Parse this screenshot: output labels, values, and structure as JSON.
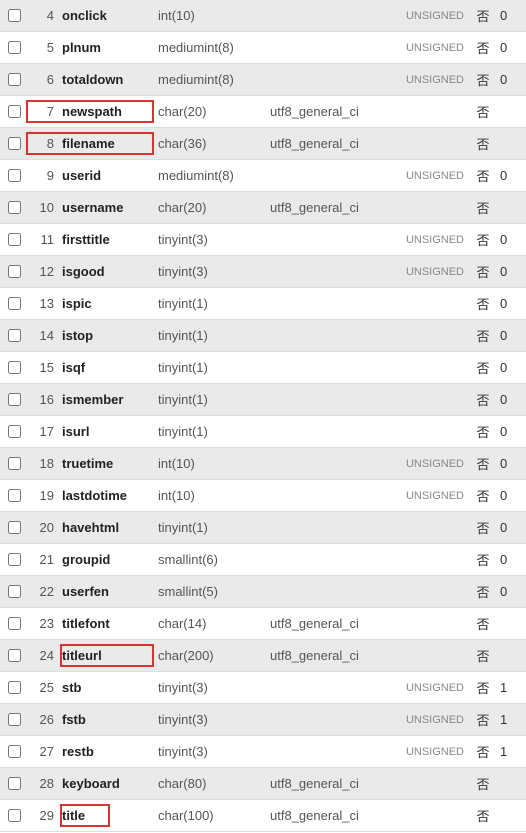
{
  "labels": {
    "unsigned": "UNSIGNED",
    "no": "否"
  },
  "rows": [
    {
      "n": "4",
      "name": "onclick",
      "type": "int(10)",
      "coll": "",
      "attr": "UNSIGNED",
      "nul": "否",
      "dft": "0",
      "alt": true,
      "hl": false
    },
    {
      "n": "5",
      "name": "plnum",
      "type": "mediumint(8)",
      "coll": "",
      "attr": "UNSIGNED",
      "nul": "否",
      "dft": "0",
      "alt": false,
      "hl": false
    },
    {
      "n": "6",
      "name": "totaldown",
      "type": "mediumint(8)",
      "coll": "",
      "attr": "UNSIGNED",
      "nul": "否",
      "dft": "0",
      "alt": true,
      "hl": false
    },
    {
      "n": "7",
      "name": "newspath",
      "type": "char(20)",
      "coll": "utf8_general_ci",
      "attr": "",
      "nul": "否",
      "dft": "",
      "alt": false,
      "hl": true
    },
    {
      "n": "8",
      "name": "filename",
      "type": "char(36)",
      "coll": "utf8_general_ci",
      "attr": "",
      "nul": "否",
      "dft": "",
      "alt": true,
      "hl": true
    },
    {
      "n": "9",
      "name": "userid",
      "type": "mediumint(8)",
      "coll": "",
      "attr": "UNSIGNED",
      "nul": "否",
      "dft": "0",
      "alt": false,
      "hl": false
    },
    {
      "n": "10",
      "name": "username",
      "type": "char(20)",
      "coll": "utf8_general_ci",
      "attr": "",
      "nul": "否",
      "dft": "",
      "alt": true,
      "hl": false
    },
    {
      "n": "11",
      "name": "firsttitle",
      "type": "tinyint(3)",
      "coll": "",
      "attr": "UNSIGNED",
      "nul": "否",
      "dft": "0",
      "alt": false,
      "hl": false
    },
    {
      "n": "12",
      "name": "isgood",
      "type": "tinyint(3)",
      "coll": "",
      "attr": "UNSIGNED",
      "nul": "否",
      "dft": "0",
      "alt": true,
      "hl": false
    },
    {
      "n": "13",
      "name": "ispic",
      "type": "tinyint(1)",
      "coll": "",
      "attr": "",
      "nul": "否",
      "dft": "0",
      "alt": false,
      "hl": false
    },
    {
      "n": "14",
      "name": "istop",
      "type": "tinyint(1)",
      "coll": "",
      "attr": "",
      "nul": "否",
      "dft": "0",
      "alt": true,
      "hl": false
    },
    {
      "n": "15",
      "name": "isqf",
      "type": "tinyint(1)",
      "coll": "",
      "attr": "",
      "nul": "否",
      "dft": "0",
      "alt": false,
      "hl": false
    },
    {
      "n": "16",
      "name": "ismember",
      "type": "tinyint(1)",
      "coll": "",
      "attr": "",
      "nul": "否",
      "dft": "0",
      "alt": true,
      "hl": false
    },
    {
      "n": "17",
      "name": "isurl",
      "type": "tinyint(1)",
      "coll": "",
      "attr": "",
      "nul": "否",
      "dft": "0",
      "alt": false,
      "hl": false
    },
    {
      "n": "18",
      "name": "truetime",
      "type": "int(10)",
      "coll": "",
      "attr": "UNSIGNED",
      "nul": "否",
      "dft": "0",
      "alt": true,
      "hl": false
    },
    {
      "n": "19",
      "name": "lastdotime",
      "type": "int(10)",
      "coll": "",
      "attr": "UNSIGNED",
      "nul": "否",
      "dft": "0",
      "alt": false,
      "hl": false
    },
    {
      "n": "20",
      "name": "havehtml",
      "type": "tinyint(1)",
      "coll": "",
      "attr": "",
      "nul": "否",
      "dft": "0",
      "alt": true,
      "hl": false
    },
    {
      "n": "21",
      "name": "groupid",
      "type": "smallint(6)",
      "coll": "",
      "attr": "",
      "nul": "否",
      "dft": "0",
      "alt": false,
      "hl": false
    },
    {
      "n": "22",
      "name": "userfen",
      "type": "smallint(5)",
      "coll": "",
      "attr": "",
      "nul": "否",
      "dft": "0",
      "alt": true,
      "hl": false
    },
    {
      "n": "23",
      "name": "titlefont",
      "type": "char(14)",
      "coll": "utf8_general_ci",
      "attr": "",
      "nul": "否",
      "dft": "",
      "alt": false,
      "hl": false
    },
    {
      "n": "24",
      "name": "titleurl",
      "type": "char(200)",
      "coll": "utf8_general_ci",
      "attr": "",
      "nul": "否",
      "dft": "",
      "alt": true,
      "hl": true,
      "hlcls": "hl24"
    },
    {
      "n": "25",
      "name": "stb",
      "type": "tinyint(3)",
      "coll": "",
      "attr": "UNSIGNED",
      "nul": "否",
      "dft": "1",
      "alt": false,
      "hl": false
    },
    {
      "n": "26",
      "name": "fstb",
      "type": "tinyint(3)",
      "coll": "",
      "attr": "UNSIGNED",
      "nul": "否",
      "dft": "1",
      "alt": true,
      "hl": false
    },
    {
      "n": "27",
      "name": "restb",
      "type": "tinyint(3)",
      "coll": "",
      "attr": "UNSIGNED",
      "nul": "否",
      "dft": "1",
      "alt": false,
      "hl": false
    },
    {
      "n": "28",
      "name": "keyboard",
      "type": "char(80)",
      "coll": "utf8_general_ci",
      "attr": "",
      "nul": "否",
      "dft": "",
      "alt": true,
      "hl": false
    },
    {
      "n": "29",
      "name": "title",
      "type": "char(100)",
      "coll": "utf8_general_ci",
      "attr": "",
      "nul": "否",
      "dft": "",
      "alt": false,
      "hl": true,
      "hlcls": "hl29"
    }
  ]
}
